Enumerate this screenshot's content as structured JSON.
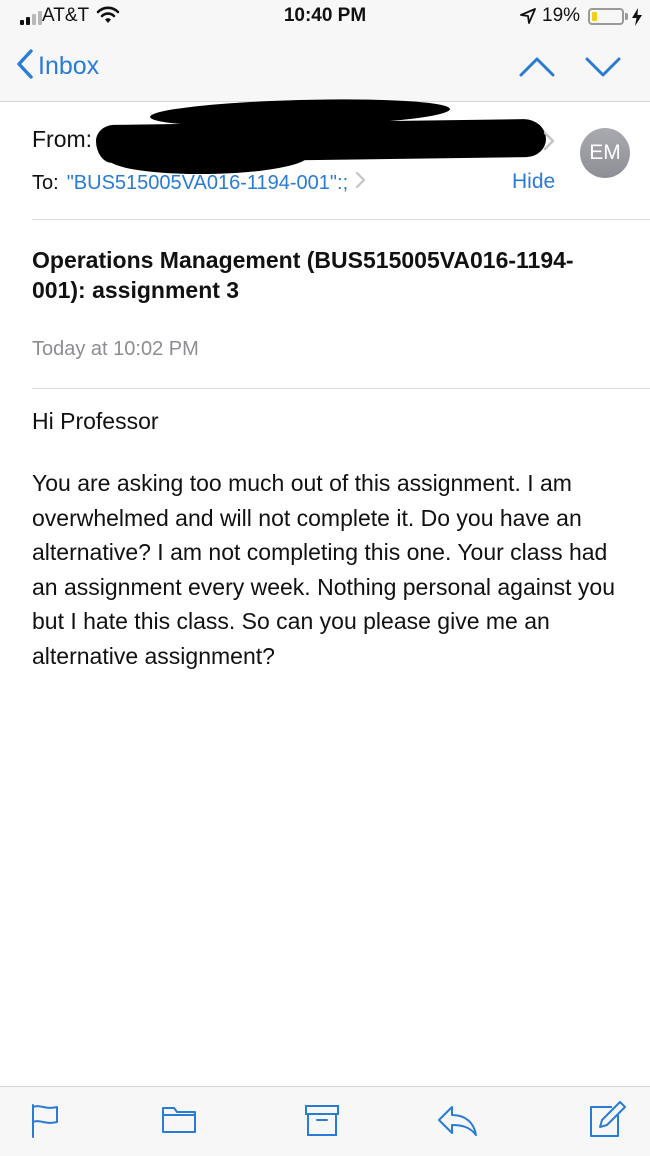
{
  "status_bar": {
    "carrier": "AT&T",
    "time": "10:40 PM",
    "battery_percent_label": "19%",
    "battery_level": 0.19,
    "signal_bars": 2,
    "icons": [
      "signal-icon",
      "wifi-icon",
      "location-arrow-icon",
      "battery-icon",
      "charging-bolt-icon"
    ]
  },
  "nav": {
    "back_label": "Inbox",
    "icons": [
      "chevron-left-icon",
      "chevron-up-icon",
      "chevron-down-icon"
    ]
  },
  "header": {
    "from_label": "From:",
    "to_label": "To:",
    "to_address": "\"BUS515005VA016-1194-001\":;",
    "hide_label": "Hide",
    "avatar_initials": "EM"
  },
  "message": {
    "subject": "Operations Management (BUS515005VA016-1194-001): assignment 3",
    "date": "Today at 10:02 PM",
    "greeting": "Hi Professor",
    "body": "You are asking too much out of this assignment. I am overwhelmed and will not complete it. Do you have an alternative? I am not completing this one. Your class had an assignment every week. Nothing personal against you but I hate this class. So can you please give me an alternative assignment?"
  },
  "toolbar": {
    "icons": [
      "flag-icon",
      "folder-icon",
      "archive-icon",
      "reply-icon",
      "compose-icon"
    ]
  },
  "colors": {
    "accent": "#2a7bd6",
    "bar_background": "#f7f7f7",
    "secondary_text": "#8d8d92",
    "battery_fill": "#f4cf1a",
    "avatar": "#9a9ba1"
  }
}
